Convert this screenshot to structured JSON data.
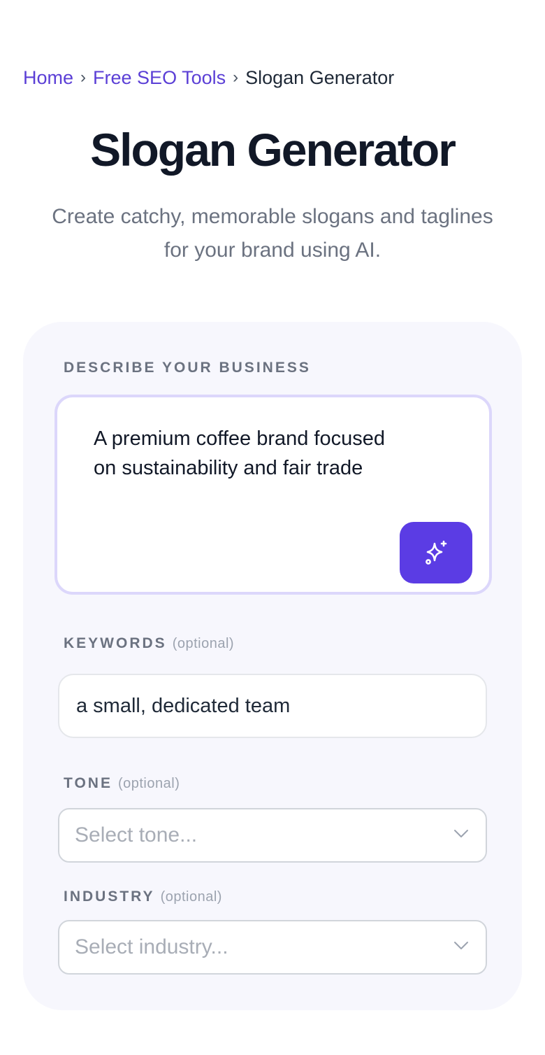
{
  "breadcrumb": {
    "items": [
      "Home",
      "Free SEO Tools",
      "Slogan Generator"
    ],
    "separator": "›"
  },
  "header": {
    "title": "Slogan Generator",
    "subtitle_line1": "Create catchy, memorable slogans and taglines",
    "subtitle_line2": "for your brand using AI."
  },
  "form": {
    "description": {
      "label": "DESCRIBE YOUR BUSINESS",
      "value_line1": "A premium coffee brand focused",
      "value_line2": "on sustainability and fair trade",
      "button_icon": "sparkles-icon"
    },
    "keywords": {
      "label": "KEYWORDS",
      "optional": "(optional)",
      "value": "a small, dedicated team"
    },
    "tone": {
      "label": "TONE",
      "optional": "(optional)",
      "placeholder": "Select tone..."
    },
    "industry": {
      "label": "INDUSTRY",
      "optional": "(optional)",
      "placeholder": "Select industry..."
    }
  },
  "colors": {
    "accent": "#5b3ce4",
    "link": "#5b3fd6",
    "card_bg": "#f7f7fd",
    "focus_border": "#dcd7fb"
  }
}
